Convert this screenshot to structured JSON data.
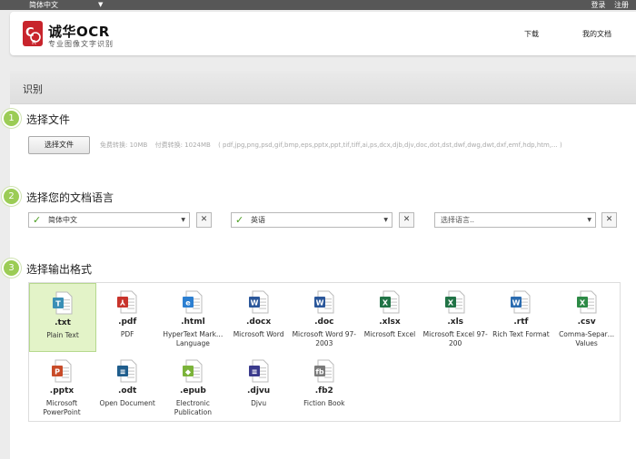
{
  "topbar": {
    "language": "简体中文",
    "caret": "▼",
    "login": "登录",
    "register": "注册"
  },
  "header": {
    "logo_title": "诚华OCR",
    "logo_sub": "专业图像文字识别",
    "nav_download": "下载",
    "nav_mydocs": "我的文档"
  },
  "panel": {
    "title": "识别"
  },
  "step1": {
    "num": "1",
    "title": "选择文件",
    "button": "选择文件",
    "free_limit": "免费转换: 10MB",
    "paid_limit": "付费转换: 1024MB",
    "formats": "( pdf,jpg,png,psd,gif,bmp,eps,pptx,ppt,tif,tiff,ai,ps,dcx,djb,djv,doc,dot,dst,dwf,dwg,dwt,dxf,emf,hdp,htm,... )"
  },
  "step2": {
    "num": "2",
    "title": "选择您的文档语言",
    "lang1": "简体中文",
    "lang2": "英语",
    "lang3_placeholder": "选择语言..",
    "clear": "✕",
    "arrow": "▼",
    "check": "✓"
  },
  "step3": {
    "num": "3",
    "title": "选择输出格式",
    "formats": [
      {
        "ext": ".txt",
        "desc": "Plain Text",
        "icon": "text-file-icon",
        "color": "#3a8fb5"
      },
      {
        "ext": ".pdf",
        "desc": "PDF",
        "icon": "pdf-file-icon",
        "color": "#c8342c"
      },
      {
        "ext": ".html",
        "desc": "HyperText Mark… Language",
        "icon": "html-file-icon",
        "color": "#2c7fd1"
      },
      {
        "ext": ".docx",
        "desc": "Microsoft Word",
        "icon": "word-file-icon",
        "color": "#2b579a"
      },
      {
        "ext": ".doc",
        "desc": "Microsoft Word 97-2003",
        "icon": "word-file-icon",
        "color": "#2b579a"
      },
      {
        "ext": ".xlsx",
        "desc": "Microsoft Excel",
        "icon": "excel-file-icon",
        "color": "#217346"
      },
      {
        "ext": ".xls",
        "desc": "Microsoft Excel 97-200",
        "icon": "excel-file-icon",
        "color": "#217346"
      },
      {
        "ext": ".rtf",
        "desc": "Rich Text Format",
        "icon": "rtf-file-icon",
        "color": "#2b6cb0"
      },
      {
        "ext": ".csv",
        "desc": "Comma-Separ… Values",
        "icon": "csv-file-icon",
        "color": "#2d8a46"
      },
      {
        "ext": ".pptx",
        "desc": "Microsoft PowerPoint",
        "icon": "powerpoint-file-icon",
        "color": "#c84b28"
      },
      {
        "ext": ".odt",
        "desc": "Open Document",
        "icon": "odt-file-icon",
        "color": "#1f5d8c"
      },
      {
        "ext": ".epub",
        "desc": "Electronic Publication",
        "icon": "epub-file-icon",
        "color": "#7bb33a"
      },
      {
        "ext": ".djvu",
        "desc": "Djvu",
        "icon": "djvu-file-icon",
        "color": "#3a3a8c"
      },
      {
        "ext": ".fb2",
        "desc": "Fiction Book",
        "icon": "fb2-file-icon",
        "color": "#7a7a7a"
      }
    ]
  }
}
